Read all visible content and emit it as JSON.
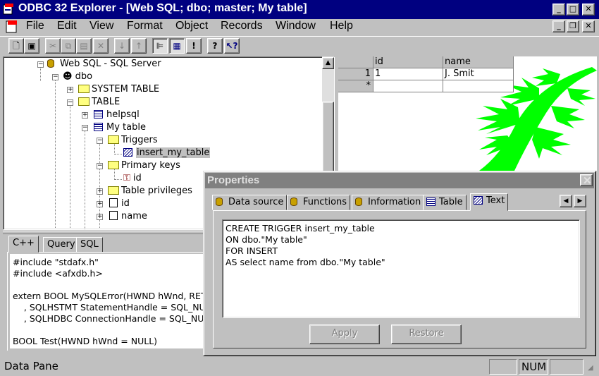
{
  "window": {
    "title": "ODBC 32 Explorer - [Web SQL; dbo; master; My table]",
    "caption_buttons": [
      "minimize-icon",
      "maximize-icon",
      "close-icon"
    ],
    "child_buttons": [
      "minimize-icon",
      "restore-icon",
      "close-icon"
    ]
  },
  "menu": [
    "File",
    "Edit",
    "View",
    "Format",
    "Object",
    "Records",
    "Window",
    "Help"
  ],
  "toolbar": [
    "new-icon",
    "save-icon",
    "cut-icon",
    "copy-icon",
    "paste-icon",
    "delete-icon",
    "sort-ascending-icon",
    "sort-descending-icon",
    "tree-view-icon",
    "properties-icon",
    "exclamation-icon",
    "help-icon",
    "context-help-icon"
  ],
  "tree": {
    "server": "Web SQL - SQL Server",
    "owner": "dbo",
    "system_table": "SYSTEM TABLE",
    "table": "TABLE",
    "helpsql": "helpsql",
    "my_table": "My table",
    "triggers": "Triggers",
    "trigger_item": "insert_my_table",
    "primary_keys": "Primary keys",
    "pk_item": "id",
    "table_privileges": "Table privileges",
    "col_id": "id",
    "col_name": "name"
  },
  "grid": {
    "columns": [
      "id",
      "name"
    ],
    "rows": [
      {
        "row_header": "1",
        "id": "1",
        "name": "J. Smit"
      },
      {
        "row_header": "*",
        "id": "",
        "name": ""
      }
    ]
  },
  "code_tabs": [
    "C++",
    "Query",
    "SQL"
  ],
  "code_lines": [
    "#include \"stdafx.h\"",
    "#include <afxdb.h>",
    "",
    "extern BOOL MySQLError(HWND hWnd, RET",
    "    , SQLHSTMT StatementHandle = SQL_NUL",
    "    , SQLHDBC ConnectionHandle = SQL_NULL",
    "",
    "BOOL Test(HWND hWnd = NULL)"
  ],
  "properties": {
    "title": "Properties",
    "tabs": [
      "Data source",
      "Functions",
      "Information",
      "Table",
      "Text"
    ],
    "active_tab": "Text",
    "text_lines": [
      "CREATE TRIGGER insert_my_table",
      "ON dbo.\"My table\"",
      "FOR INSERT",
      "AS select name from dbo.\"My table\""
    ],
    "apply_label": "Apply",
    "restore_label": "Restore"
  },
  "status": {
    "text": "Data Pane",
    "num": "NUM"
  },
  "colors": {
    "titlebar": "#000080",
    "fern": "#00ff00",
    "face": "#c0c0c0"
  }
}
